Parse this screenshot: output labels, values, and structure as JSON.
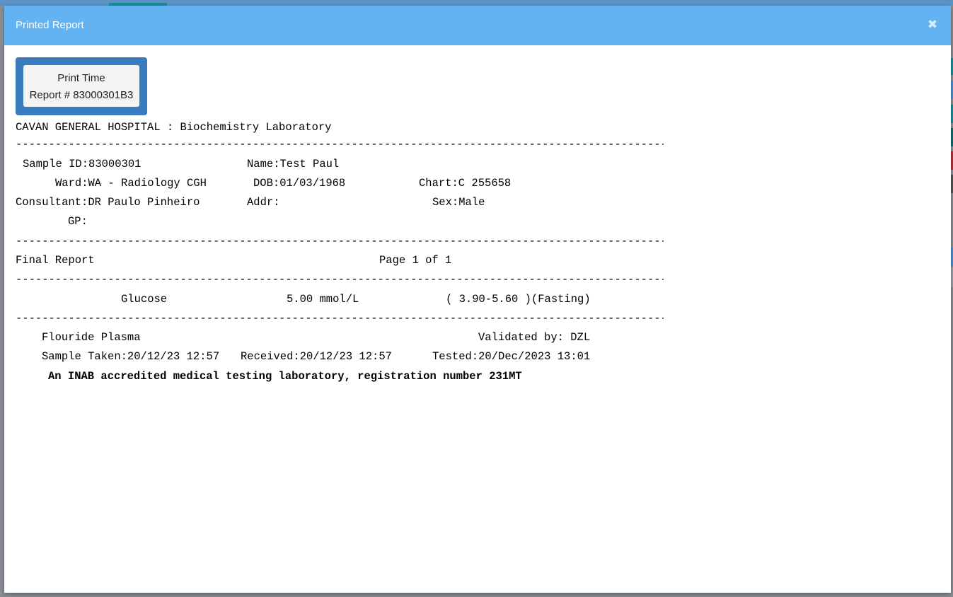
{
  "modal": {
    "title": "Printed Report",
    "close_glyph": "✖",
    "close_icon": "close-icon"
  },
  "print_button": {
    "line1": "Print Time",
    "line2": "Report # 83000301B3"
  },
  "report": {
    "header": "CAVAN GENERAL HOSPITAL : Biochemistry Laboratory",
    "separator": "--------------------------------------------------------------------------------------------------------------------------------------------------",
    "sample_id": "Sample ID:83000301",
    "name": "Name:Test Paul",
    "ward": "Ward:WA - Radiology CGH",
    "dob": "DOB:01/03/1968",
    "chart": "Chart:C 255658",
    "consultant": "Consultant:DR Paulo Pinheiro",
    "addr": "Addr:",
    "sex": "Sex:Male",
    "gp": "GP:",
    "status": "Final Report",
    "page": "Page 1 of 1",
    "test_name": "Glucose",
    "test_value": "5.00 mmol/L",
    "test_range": "( 3.90-5.60 )(Fasting)",
    "specimen": "Flouride Plasma",
    "validated": "Validated by: DZL",
    "sample_taken": "Sample Taken:20/12/23 12:57",
    "received": "Received:20/12/23 12:57",
    "tested": "Tested:20/Dec/2023 13:01",
    "accreditation": "An INAB accredited medical testing laboratory, registration number 231MT"
  },
  "colors": {
    "header_bg": "#63b3f3",
    "print_frame": "#3a7bbd",
    "button_bg": "#f4f4f4"
  }
}
